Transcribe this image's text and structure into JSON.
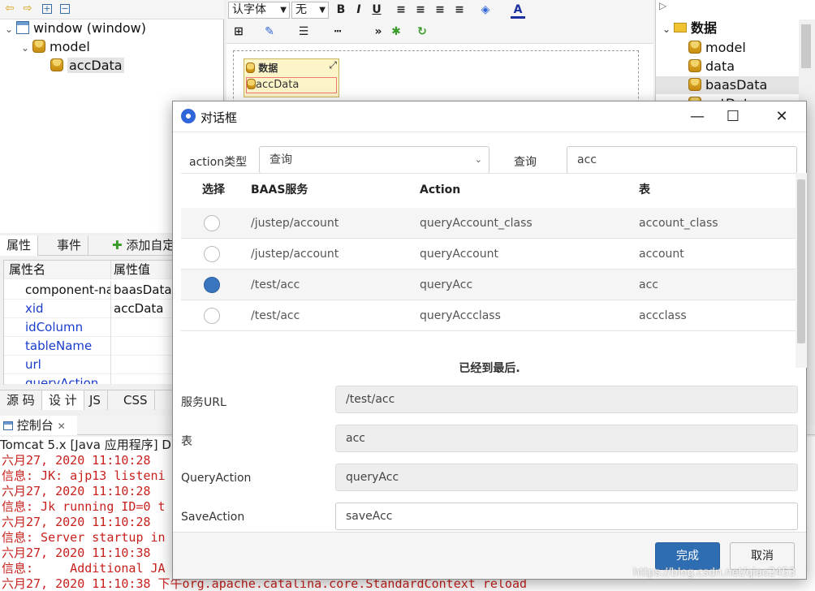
{
  "tree": {
    "root": "window (window)",
    "model": "model",
    "child": "accData"
  },
  "props": {
    "tabs": [
      "属性",
      "事件",
      "添加自定"
    ],
    "header": {
      "name": "属性名",
      "value": "属性值"
    },
    "rows": [
      {
        "name": "component-na",
        "value": "baasData-"
      },
      {
        "name": "xid",
        "value": "accData"
      },
      {
        "name": "idColumn",
        "value": ""
      },
      {
        "name": "tableName",
        "value": ""
      },
      {
        "name": "url",
        "value": ""
      },
      {
        "name": "queryAction",
        "value": ""
      }
    ]
  },
  "editor_tabs": [
    "源 码",
    "设 计",
    "JS",
    "CSS"
  ],
  "editor_toolbar": {
    "font": "认字体",
    "size": "无"
  },
  "canvas": {
    "comp_title": "数据",
    "comp_item": "accData"
  },
  "rtree": {
    "root": "数据",
    "items": [
      "model",
      "data",
      "baasData",
      "ectData"
    ]
  },
  "console": {
    "tab": "控制台",
    "header": "Tomcat 5.x [Java 应用程序] D:\\",
    "lines": [
      "六月27, 2020 11:10:28 ",
      "信息: JK: ajp13 listeni",
      "六月27, 2020 11:10:28 ",
      "信息: Jk running ID=0 t",
      "六月27, 2020 11:10:28 ",
      "信息: Server startup in",
      "六月27, 2020 11:10:38 ",
      "信息:     Additional JA",
      "六月27, 2020 11:10:38 下午org.apache.catalina.core.StandardContext reload"
    ]
  },
  "dialog": {
    "title": "对话框",
    "action_type_label": "action类型",
    "action_type_value": "查询",
    "query_label": "查询",
    "query_value": "acc",
    "columns": [
      "选择",
      "BAAS服务",
      "Action",
      "表"
    ],
    "rows": [
      {
        "selected": false,
        "service": "/justep/account",
        "action": "queryAccount_class",
        "table": "account_class"
      },
      {
        "selected": false,
        "service": "/justep/account",
        "action": "queryAccount",
        "table": "account"
      },
      {
        "selected": true,
        "service": "/test/acc",
        "action": "queryAcc",
        "table": "acc"
      },
      {
        "selected": false,
        "service": "/test/acc",
        "action": "queryAccclass",
        "table": "accclass"
      }
    ],
    "end_message": "已经到最后.",
    "fields": [
      {
        "label": "服务URL",
        "value": "/test/acc"
      },
      {
        "label": "表",
        "value": "acc"
      },
      {
        "label": "QueryAction",
        "value": "queryAcc"
      },
      {
        "label": "SaveAction",
        "value": "saveAcc"
      }
    ],
    "done_label": "完成",
    "cancel_label": "取消"
  },
  "watermark": "https://blog.csdn.net/qiao2453"
}
